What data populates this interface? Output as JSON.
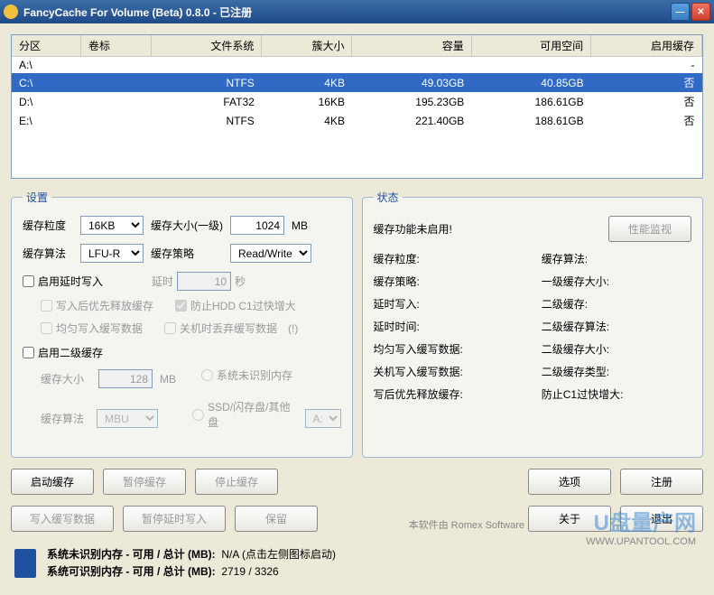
{
  "title": "FancyCache For Volume (Beta) 0.8.0 - 已注册",
  "table": {
    "headers": [
      "分区",
      "卷标",
      "文件系统",
      "簇大小",
      "容量",
      "可用空间",
      "启用缓存"
    ],
    "rows": [
      {
        "drive": "A:\\",
        "label": "",
        "fs": "",
        "cluster": "",
        "capacity": "",
        "free": "",
        "cached": "-"
      },
      {
        "drive": "C:\\",
        "label": "",
        "fs": "NTFS",
        "cluster": "4KB",
        "capacity": "49.03GB",
        "free": "40.85GB",
        "cached": "否",
        "selected": true
      },
      {
        "drive": "D:\\",
        "label": "",
        "fs": "FAT32",
        "cluster": "16KB",
        "capacity": "195.23GB",
        "free": "186.61GB",
        "cached": "否"
      },
      {
        "drive": "E:\\",
        "label": "",
        "fs": "NTFS",
        "cluster": "4KB",
        "capacity": "221.40GB",
        "free": "188.61GB",
        "cached": "否"
      }
    ]
  },
  "settings": {
    "legend": "设置",
    "granularity_lbl": "缓存粒度",
    "granularity_val": "16KB",
    "algorithm_lbl": "缓存算法",
    "algorithm_val": "LFU-R",
    "size_lbl": "缓存大小(一级)",
    "size_val": "1024",
    "size_unit": "MB",
    "strategy_lbl": "缓存策略",
    "strategy_val": "Read/Write",
    "defer_lbl": "启用延时写入",
    "delay_lbl": "延时",
    "delay_val": "10",
    "delay_unit": "秒",
    "release_lbl": "写入后优先释放缓存",
    "prevent_lbl": "防止HDD C1过快增大",
    "avg_lbl": "均匀写入缓写数据",
    "discard_lbl": "关机时丢弃缓写数据",
    "help": "(!)",
    "l2_lbl": "启用二级缓存",
    "l2size_lbl": "缓存大小",
    "l2size_val": "128",
    "l2size_unit": "MB",
    "l2algo_lbl": "缓存算法",
    "l2algo_val": "MBU",
    "unrecog_lbl": "系统未识别内存",
    "ssd_lbl": "SSD/闪存盘/其他盘",
    "ssd_drive": "A:"
  },
  "status": {
    "legend": "状态",
    "not_enabled": "缓存功能未启用!",
    "perf_btn": "性能监视",
    "items": [
      "缓存粒度:",
      "缓存算法:",
      "缓存策略:",
      "一级缓存大小:",
      "延时写入:",
      "二级缓存:",
      "延时时间:",
      "二级缓存算法:",
      "均匀写入缓写数据:",
      "二级缓存大小:",
      "关机写入缓写数据:",
      "二级缓存类型:",
      "写后优先释放缓存:",
      "防止C1过快增大:"
    ]
  },
  "buttons": {
    "start": "启动缓存",
    "pause": "暂停缓存",
    "stop": "停止缓存",
    "write": "写入缓写数据",
    "pause_defer": "暂停延时写入",
    "keep": "保留",
    "options": "选项",
    "register": "注册",
    "about": "关于",
    "exit": "退出"
  },
  "memory": {
    "unrecog": "系统未识别内存 - 可用 / 总计 (MB):",
    "unrecog_val": "N/A (点击左侧图标启动)",
    "recog": "系统可识别内存 - 可用 / 总计 (MB):",
    "recog_val": "2719 / 3326"
  },
  "footer": "本软件由 Romex Software",
  "watermark": "U盘量产网",
  "watermark_url": "WWW.UPANTOOL.COM"
}
